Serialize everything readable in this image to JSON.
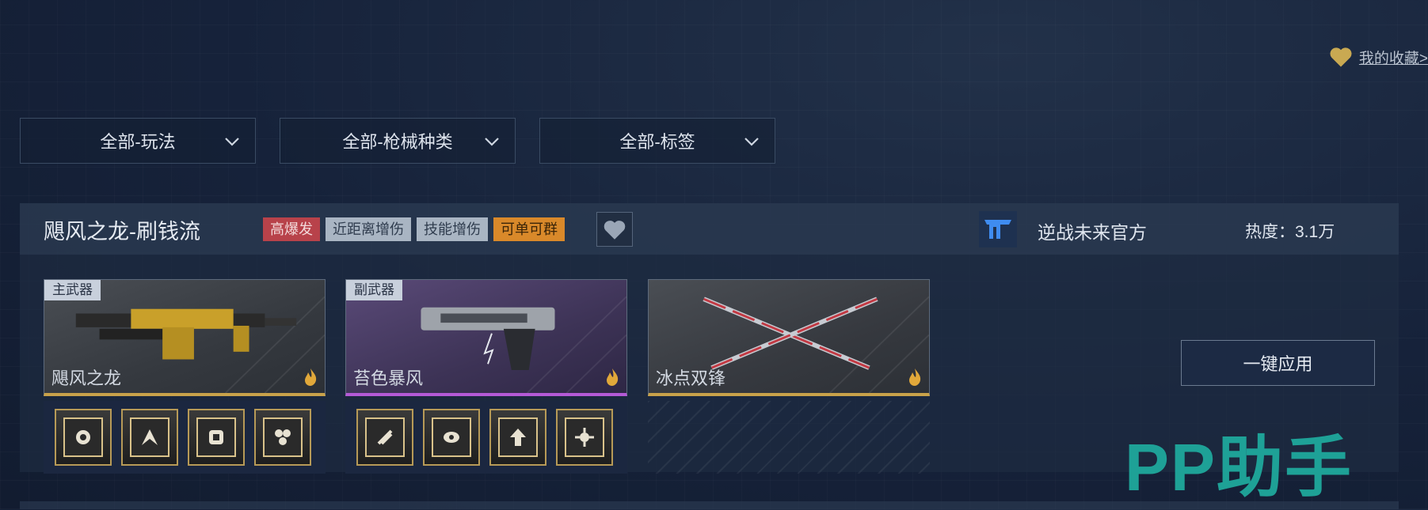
{
  "favorites_link": "我的收藏>",
  "filters": [
    {
      "value": "全部-玩法"
    },
    {
      "value": "全部-枪械种类"
    },
    {
      "value": "全部-标签"
    }
  ],
  "card": {
    "title": "飓风之龙-刷钱流",
    "tags": [
      "高爆发",
      "近距离增伤",
      "技能增伤",
      "可单可群"
    ],
    "author": "逆战未来官方",
    "heat": "热度：3.1万",
    "weapons": [
      {
        "slot": "主武器",
        "name": "飓风之龙"
      },
      {
        "slot": "副武器",
        "name": "苔色暴风"
      },
      {
        "slot": "",
        "name": "冰点双锋"
      }
    ],
    "apply_button": "一键应用"
  },
  "watermark": "PP助手",
  "colors": {
    "tag_red": "#b8424a",
    "tag_gray": "#a9b5c3",
    "tag_orange": "#d9892a",
    "gold_rarity": "#c8a24a",
    "purple_rarity": "#b45ad6",
    "watermark": "#1fa89c"
  }
}
